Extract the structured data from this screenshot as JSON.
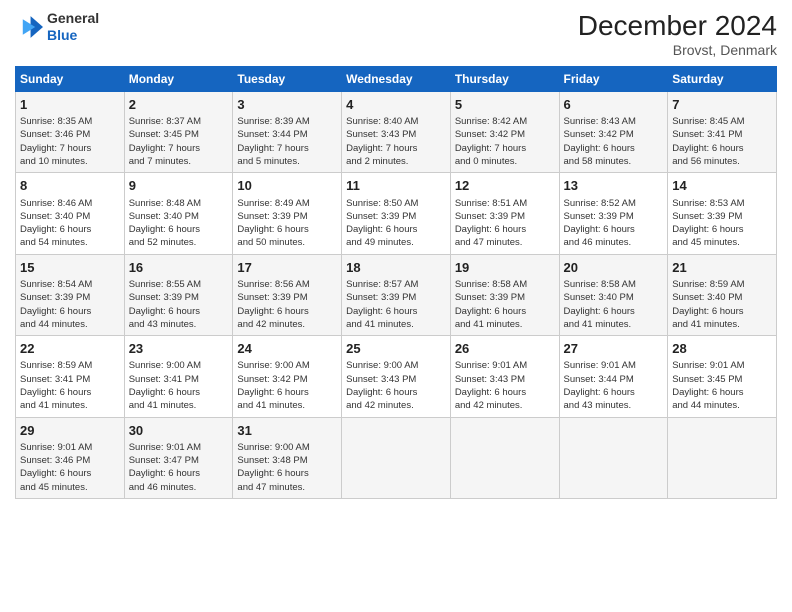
{
  "header": {
    "logo_line1": "General",
    "logo_line2": "Blue",
    "title": "December 2024",
    "subtitle": "Brovst, Denmark"
  },
  "calendar": {
    "columns": [
      "Sunday",
      "Monday",
      "Tuesday",
      "Wednesday",
      "Thursday",
      "Friday",
      "Saturday"
    ],
    "weeks": [
      [
        {
          "day": "1",
          "lines": [
            "Sunrise: 8:35 AM",
            "Sunset: 3:46 PM",
            "Daylight: 7 hours",
            "and 10 minutes."
          ]
        },
        {
          "day": "2",
          "lines": [
            "Sunrise: 8:37 AM",
            "Sunset: 3:45 PM",
            "Daylight: 7 hours",
            "and 7 minutes."
          ]
        },
        {
          "day": "3",
          "lines": [
            "Sunrise: 8:39 AM",
            "Sunset: 3:44 PM",
            "Daylight: 7 hours",
            "and 5 minutes."
          ]
        },
        {
          "day": "4",
          "lines": [
            "Sunrise: 8:40 AM",
            "Sunset: 3:43 PM",
            "Daylight: 7 hours",
            "and 2 minutes."
          ]
        },
        {
          "day": "5",
          "lines": [
            "Sunrise: 8:42 AM",
            "Sunset: 3:42 PM",
            "Daylight: 7 hours",
            "and 0 minutes."
          ]
        },
        {
          "day": "6",
          "lines": [
            "Sunrise: 8:43 AM",
            "Sunset: 3:42 PM",
            "Daylight: 6 hours",
            "and 58 minutes."
          ]
        },
        {
          "day": "7",
          "lines": [
            "Sunrise: 8:45 AM",
            "Sunset: 3:41 PM",
            "Daylight: 6 hours",
            "and 56 minutes."
          ]
        }
      ],
      [
        {
          "day": "8",
          "lines": [
            "Sunrise: 8:46 AM",
            "Sunset: 3:40 PM",
            "Daylight: 6 hours",
            "and 54 minutes."
          ]
        },
        {
          "day": "9",
          "lines": [
            "Sunrise: 8:48 AM",
            "Sunset: 3:40 PM",
            "Daylight: 6 hours",
            "and 52 minutes."
          ]
        },
        {
          "day": "10",
          "lines": [
            "Sunrise: 8:49 AM",
            "Sunset: 3:39 PM",
            "Daylight: 6 hours",
            "and 50 minutes."
          ]
        },
        {
          "day": "11",
          "lines": [
            "Sunrise: 8:50 AM",
            "Sunset: 3:39 PM",
            "Daylight: 6 hours",
            "and 49 minutes."
          ]
        },
        {
          "day": "12",
          "lines": [
            "Sunrise: 8:51 AM",
            "Sunset: 3:39 PM",
            "Daylight: 6 hours",
            "and 47 minutes."
          ]
        },
        {
          "day": "13",
          "lines": [
            "Sunrise: 8:52 AM",
            "Sunset: 3:39 PM",
            "Daylight: 6 hours",
            "and 46 minutes."
          ]
        },
        {
          "day": "14",
          "lines": [
            "Sunrise: 8:53 AM",
            "Sunset: 3:39 PM",
            "Daylight: 6 hours",
            "and 45 minutes."
          ]
        }
      ],
      [
        {
          "day": "15",
          "lines": [
            "Sunrise: 8:54 AM",
            "Sunset: 3:39 PM",
            "Daylight: 6 hours",
            "and 44 minutes."
          ]
        },
        {
          "day": "16",
          "lines": [
            "Sunrise: 8:55 AM",
            "Sunset: 3:39 PM",
            "Daylight: 6 hours",
            "and 43 minutes."
          ]
        },
        {
          "day": "17",
          "lines": [
            "Sunrise: 8:56 AM",
            "Sunset: 3:39 PM",
            "Daylight: 6 hours",
            "and 42 minutes."
          ]
        },
        {
          "day": "18",
          "lines": [
            "Sunrise: 8:57 AM",
            "Sunset: 3:39 PM",
            "Daylight: 6 hours",
            "and 41 minutes."
          ]
        },
        {
          "day": "19",
          "lines": [
            "Sunrise: 8:58 AM",
            "Sunset: 3:39 PM",
            "Daylight: 6 hours",
            "and 41 minutes."
          ]
        },
        {
          "day": "20",
          "lines": [
            "Sunrise: 8:58 AM",
            "Sunset: 3:40 PM",
            "Daylight: 6 hours",
            "and 41 minutes."
          ]
        },
        {
          "day": "21",
          "lines": [
            "Sunrise: 8:59 AM",
            "Sunset: 3:40 PM",
            "Daylight: 6 hours",
            "and 41 minutes."
          ]
        }
      ],
      [
        {
          "day": "22",
          "lines": [
            "Sunrise: 8:59 AM",
            "Sunset: 3:41 PM",
            "Daylight: 6 hours",
            "and 41 minutes."
          ]
        },
        {
          "day": "23",
          "lines": [
            "Sunrise: 9:00 AM",
            "Sunset: 3:41 PM",
            "Daylight: 6 hours",
            "and 41 minutes."
          ]
        },
        {
          "day": "24",
          "lines": [
            "Sunrise: 9:00 AM",
            "Sunset: 3:42 PM",
            "Daylight: 6 hours",
            "and 41 minutes."
          ]
        },
        {
          "day": "25",
          "lines": [
            "Sunrise: 9:00 AM",
            "Sunset: 3:43 PM",
            "Daylight: 6 hours",
            "and 42 minutes."
          ]
        },
        {
          "day": "26",
          "lines": [
            "Sunrise: 9:01 AM",
            "Sunset: 3:43 PM",
            "Daylight: 6 hours",
            "and 42 minutes."
          ]
        },
        {
          "day": "27",
          "lines": [
            "Sunrise: 9:01 AM",
            "Sunset: 3:44 PM",
            "Daylight: 6 hours",
            "and 43 minutes."
          ]
        },
        {
          "day": "28",
          "lines": [
            "Sunrise: 9:01 AM",
            "Sunset: 3:45 PM",
            "Daylight: 6 hours",
            "and 44 minutes."
          ]
        }
      ],
      [
        {
          "day": "29",
          "lines": [
            "Sunrise: 9:01 AM",
            "Sunset: 3:46 PM",
            "Daylight: 6 hours",
            "and 45 minutes."
          ]
        },
        {
          "day": "30",
          "lines": [
            "Sunrise: 9:01 AM",
            "Sunset: 3:47 PM",
            "Daylight: 6 hours",
            "and 46 minutes."
          ]
        },
        {
          "day": "31",
          "lines": [
            "Sunrise: 9:00 AM",
            "Sunset: 3:48 PM",
            "Daylight: 6 hours",
            "and 47 minutes."
          ]
        },
        null,
        null,
        null,
        null
      ]
    ]
  }
}
